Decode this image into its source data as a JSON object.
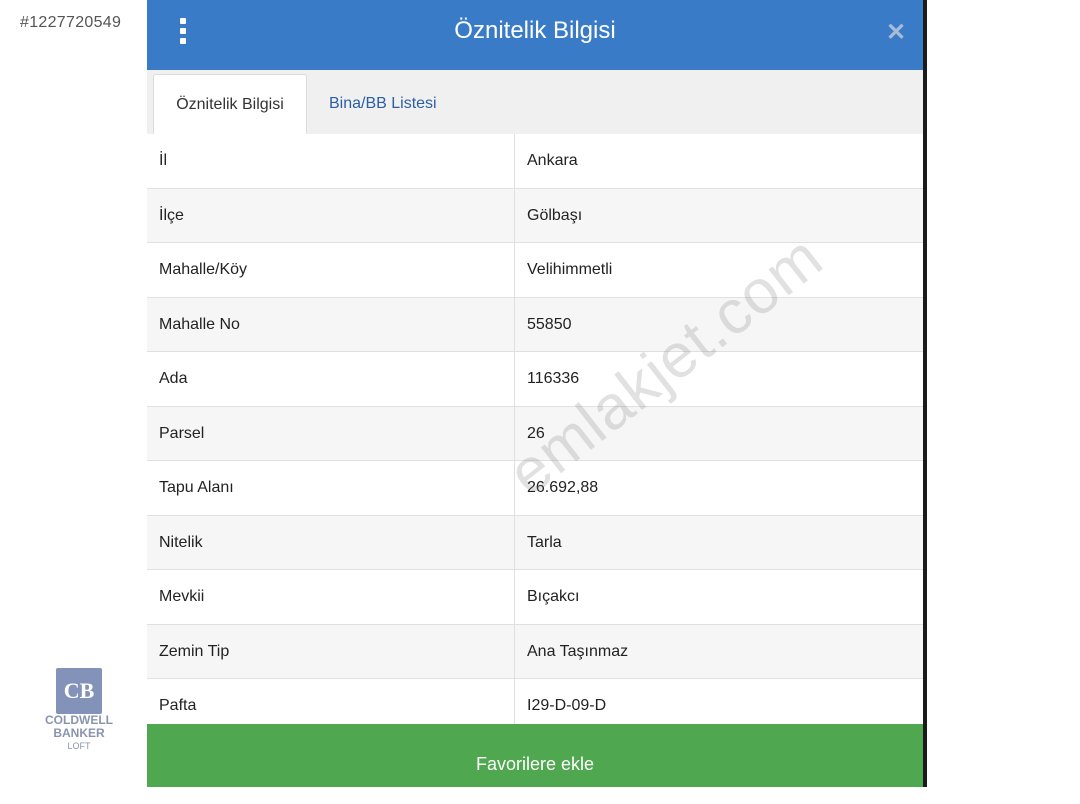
{
  "listing_id": "#1227720549",
  "header": {
    "title": "Öznitelik Bilgisi"
  },
  "tabs": [
    {
      "label": "Öznitelik Bilgisi",
      "active": true
    },
    {
      "label": "Bina/BB Listesi",
      "active": false
    }
  ],
  "rows": [
    {
      "key": "İl",
      "value": "Ankara"
    },
    {
      "key": "İlçe",
      "value": "Gölbaşı"
    },
    {
      "key": "Mahalle/Köy",
      "value": "Velihimmetli"
    },
    {
      "key": "Mahalle No",
      "value": "55850"
    },
    {
      "key": "Ada",
      "value": "116336"
    },
    {
      "key": "Parsel",
      "value": "26"
    },
    {
      "key": "Tapu Alanı",
      "value": "26.692,88"
    },
    {
      "key": "Nitelik",
      "value": "Tarla"
    },
    {
      "key": "Mevkii",
      "value": "Bıçakcı"
    },
    {
      "key": "Zemin Tip",
      "value": "Ana Taşınmaz"
    },
    {
      "key": "Pafta",
      "value": "I29-D-09-D"
    }
  ],
  "favorite_button": "Favorilere ekle",
  "watermark": "emlakjet.com",
  "logo": {
    "mark": "CB",
    "line1": "COLDWELL",
    "line2": "BANKER",
    "line3": "LOFT"
  },
  "colors": {
    "header": "#3a7bc8",
    "button": "#4fa84f",
    "tab_link": "#2a5fa4"
  }
}
